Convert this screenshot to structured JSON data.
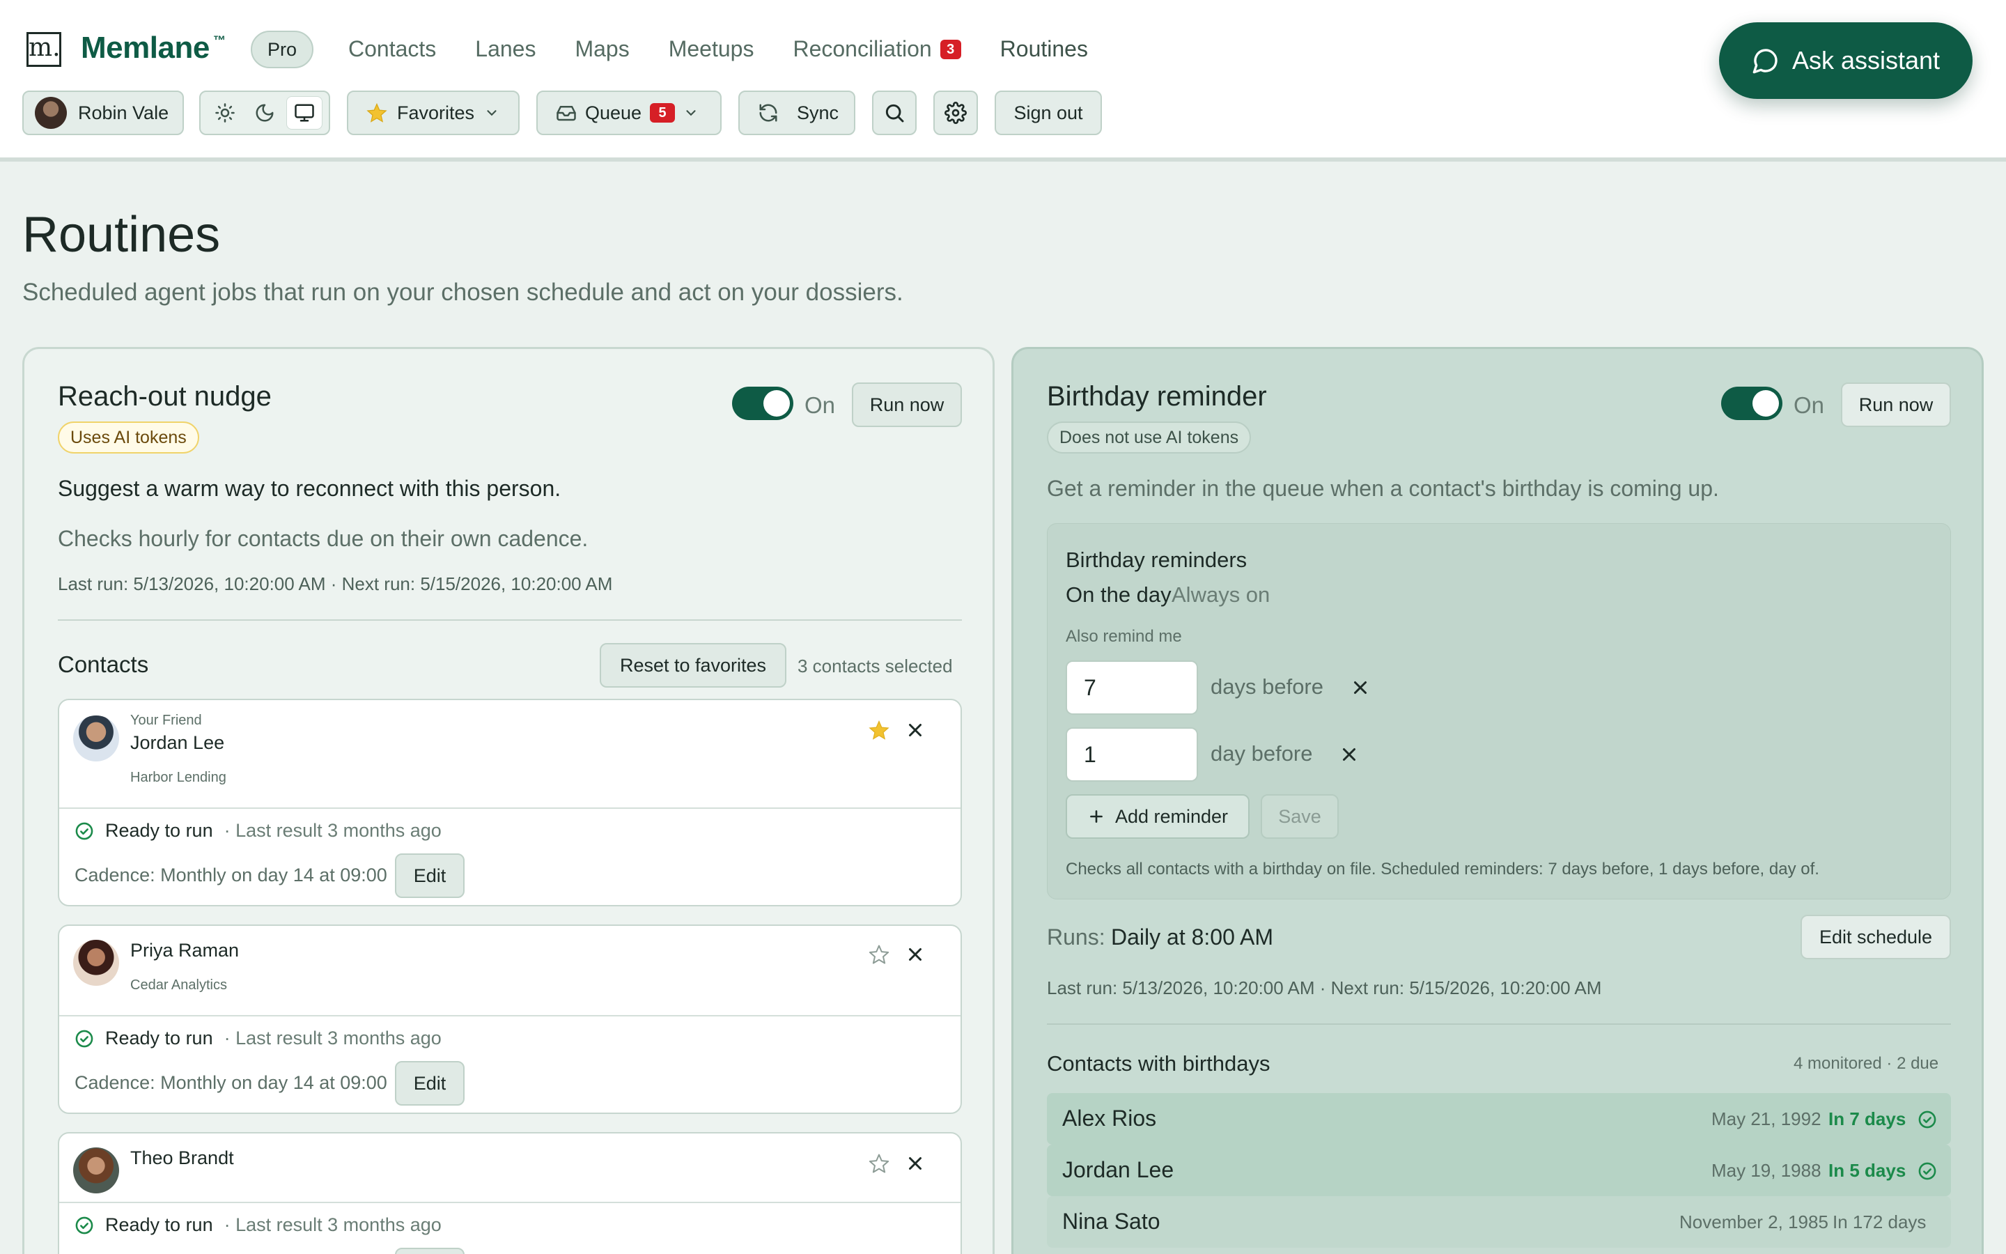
{
  "brand": {
    "logo_letter": "m.",
    "name": "Memlane",
    "tm": "™",
    "plan": "Pro"
  },
  "nav": [
    {
      "label": "Contacts"
    },
    {
      "label": "Lanes"
    },
    {
      "label": "Maps"
    },
    {
      "label": "Meetups"
    },
    {
      "label": "Reconciliation",
      "badge": "3"
    },
    {
      "label": "Routines"
    }
  ],
  "ask_assistant": "Ask assistant",
  "toolbar": {
    "user": "Robin Vale",
    "theme_options": [
      "light",
      "dark",
      "system"
    ],
    "theme_selected": "system",
    "favorites": "Favorites",
    "queue": "Queue",
    "queue_count": "5",
    "sync": "Sync",
    "sign_out": "Sign out"
  },
  "page": {
    "title": "Routines",
    "subtitle": "Scheduled agent jobs that run on your chosen schedule and act on your dossiers."
  },
  "reach_out": {
    "title": "Reach-out nudge",
    "toggle_label": "On",
    "run_now": "Run now",
    "tag": "Uses AI tokens",
    "description": "Suggest a warm way to reconnect with this person.",
    "schedule_note": "Checks hourly for contacts due on their own cadence.",
    "runs": "Last run: 5/13/2026, 10:20:00 AM · Next run: 5/15/2026, 10:20:00 AM",
    "contacts_heading": "Contacts",
    "reset_button": "Reset to favorites",
    "selected_count": "3 contacts selected",
    "contacts": [
      {
        "relation": "Your Friend",
        "name": "Jordan Lee",
        "company": "Harbor Lending",
        "favorite": true,
        "status": "Ready to run",
        "last_result": "· Last result 3 months ago",
        "cadence": "Cadence: Monthly on day 14 at 09:00",
        "edit": "Edit"
      },
      {
        "relation": "",
        "name": "Priya Raman",
        "company": "Cedar Analytics",
        "favorite": false,
        "status": "Ready to run",
        "last_result": "· Last result 3 months ago",
        "cadence": "Cadence: Monthly on day 14 at 09:00",
        "edit": "Edit"
      },
      {
        "relation": "",
        "name": "Theo Brandt",
        "company": "",
        "favorite": false,
        "status": "Ready to run",
        "last_result": "· Last result 3 months ago",
        "cadence": "",
        "edit": ""
      }
    ]
  },
  "birthday": {
    "title": "Birthday reminder",
    "toggle_label": "On",
    "run_now": "Run now",
    "tag": "Does not use AI tokens",
    "description": "Get a reminder in the queue when a contact's birthday is coming up.",
    "panel_title": "Birthday reminders",
    "on_the_day": "On the day",
    "always_on": "Always on",
    "also_remind": "Also remind me",
    "reminders": [
      {
        "value": "7",
        "unit": "days before"
      },
      {
        "value": "1",
        "unit": "day before"
      }
    ],
    "add_reminder": "Add reminder",
    "save": "Save",
    "panel_note": "Checks all contacts with a birthday on file. Scheduled reminders: 7 days before, 1 days before, day of.",
    "runs_label": "Runs:",
    "runs_value": "Daily at 8:00 AM",
    "edit_schedule": "Edit schedule",
    "runs_detail": "Last run: 5/13/2026, 10:20:00 AM · Next run: 5/15/2026, 10:20:00 AM",
    "list_heading": "Contacts with birthdays",
    "list_summary": "4 monitored · 2 due",
    "list": [
      {
        "name": "Alex Rios",
        "date": "May 21, 1992",
        "in": "In 7 days",
        "due": true
      },
      {
        "name": "Jordan Lee",
        "date": "May 19, 1988",
        "in": "In 5 days",
        "due": true
      },
      {
        "name": "Nina Sato",
        "date": "November 2, 1985",
        "in": "In 172 days",
        "due": false
      }
    ]
  },
  "colors": {
    "brand": "#0e5b45",
    "badge_red": "#d61f26",
    "star_yellow": "#f2c230",
    "due_green": "#1b8a4a"
  }
}
